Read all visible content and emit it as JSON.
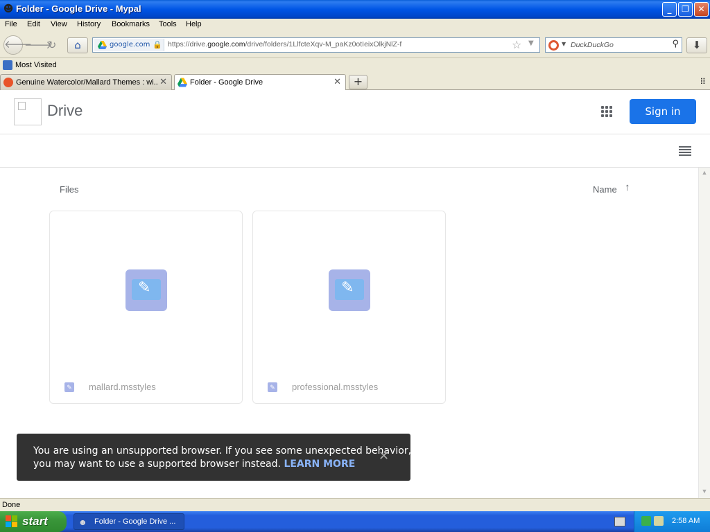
{
  "window": {
    "title": "Folder - Google Drive - Mypal"
  },
  "menu": [
    "File",
    "Edit",
    "View",
    "History",
    "Bookmarks",
    "Tools",
    "Help"
  ],
  "urlbar": {
    "site": "google.com",
    "url_prefix": "https://drive.",
    "url_domain": "google.com",
    "url_path": "/drive/folders/1LlfcteXqv-M_paKz0otIeixOlkjNlZ-f"
  },
  "search": {
    "placeholder": "DuckDuckGo"
  },
  "bookmarks": {
    "most_visited": "Most Visited"
  },
  "tabs": [
    {
      "label": "Genuine Watercolor/Mallard Themes : wi...",
      "active": false
    },
    {
      "label": "Folder - Google Drive",
      "active": true
    }
  ],
  "drive": {
    "title": "Drive",
    "signin_label": "Sign in",
    "files_label": "Files",
    "sort_label": "Name",
    "sort_arrow": "↑",
    "files": [
      {
        "name": "mallard.msstyles"
      },
      {
        "name": "professional.msstyles"
      }
    ]
  },
  "toast": {
    "line1": "You are using an unsupported browser. If you see some unexpected behavior,",
    "line2": "you may want to use a supported browser instead.",
    "link": "LEARN MORE"
  },
  "status": {
    "text": "Done"
  },
  "taskbar": {
    "start_label": "start",
    "task_label": "Folder - Google Drive ...",
    "clock": "2:58 AM"
  },
  "colors": {
    "signin_bg": "#1a73e8",
    "toast_bg": "#323232",
    "toast_link": "#8ab4f8",
    "file_thumb": "#a7b3e8"
  }
}
